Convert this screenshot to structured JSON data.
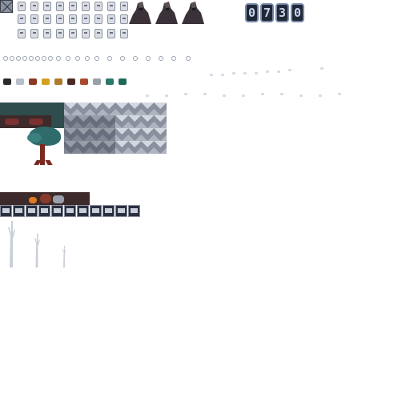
{
  "counter": {
    "digits": [
      "0",
      "7",
      "3",
      "0"
    ]
  },
  "colors": {
    "background": "#ffffff",
    "panel_dark": "#1f2838",
    "teal": "#2f4d4c",
    "rust": "#7a3131",
    "chevron_light": "#d4d8e0",
    "chevron_dark": "#6c7484"
  },
  "sprites": [
    "crossed-box-icon",
    "canister-icon",
    "rock-mound",
    "glyph-icon",
    "gem-icon",
    "ground-tile",
    "chevron-tile",
    "tree-sprite",
    "ui-slot-icon",
    "dead-tree-sprite"
  ]
}
